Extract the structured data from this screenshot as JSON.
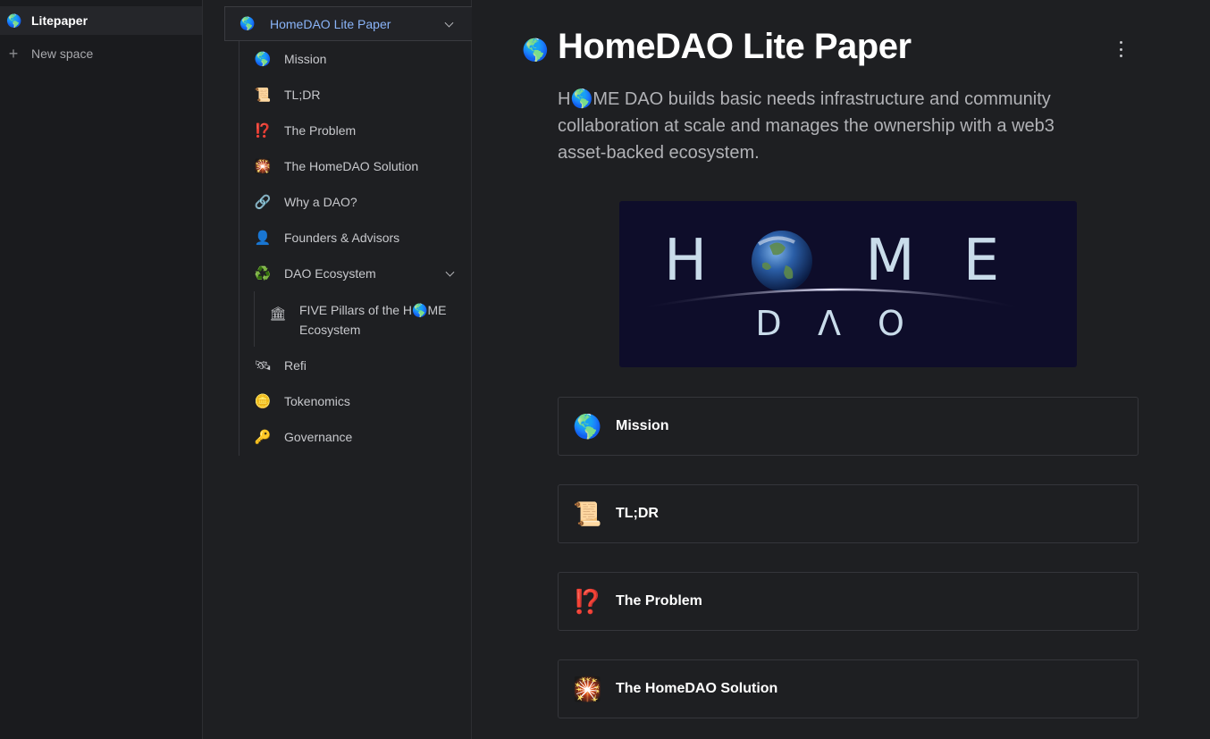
{
  "spaces": {
    "active": {
      "icon": "earth-globe-icon",
      "glyph": "🌎",
      "label": "Litepaper"
    },
    "new_space": {
      "icon": "plus-icon",
      "glyph": "+",
      "label": "New space"
    }
  },
  "toc": {
    "page": {
      "glyph": "🌎",
      "label": "HomeDAO Lite Paper"
    },
    "items": [
      {
        "glyph": "🌎",
        "label": "Mission"
      },
      {
        "glyph": "📜",
        "label": "TL;DR"
      },
      {
        "glyph": "⁉️",
        "label": "The Problem"
      },
      {
        "glyph": "🎇",
        "label": "The HomeDAO Solution"
      },
      {
        "glyph": "🔗",
        "label": "Why a DAO?"
      },
      {
        "glyph": "👤",
        "label": "Founders & Advisors"
      },
      {
        "glyph": "♻️",
        "label": "DAO Ecosystem"
      },
      {
        "glyph": "🏛",
        "label": "FIVE Pillars of the H🌎ME Ecosystem"
      },
      {
        "glyph": "🛰",
        "label": "Refi"
      },
      {
        "glyph": "🪙",
        "label": "Tokenomics"
      },
      {
        "glyph": "🔑",
        "label": "Governance"
      }
    ]
  },
  "main": {
    "title_glyph": "🌎",
    "title": "HomeDAO Lite Paper",
    "description": "H🌎ME DAO builds basic needs infrastructure and community collaboration at scale and manages the ownership with a web3 asset-backed ecosystem.",
    "banner": {
      "letters_top": [
        "H",
        "M",
        "E"
      ],
      "letters_bottom": [
        "D",
        "Λ",
        "O"
      ]
    },
    "cards": [
      {
        "glyph": "🌎",
        "label": "Mission"
      },
      {
        "glyph": "📜",
        "label": "TL;DR"
      },
      {
        "glyph": "⁉️",
        "label": "The Problem"
      },
      {
        "glyph": "🎇",
        "label": "The HomeDAO Solution"
      }
    ]
  }
}
